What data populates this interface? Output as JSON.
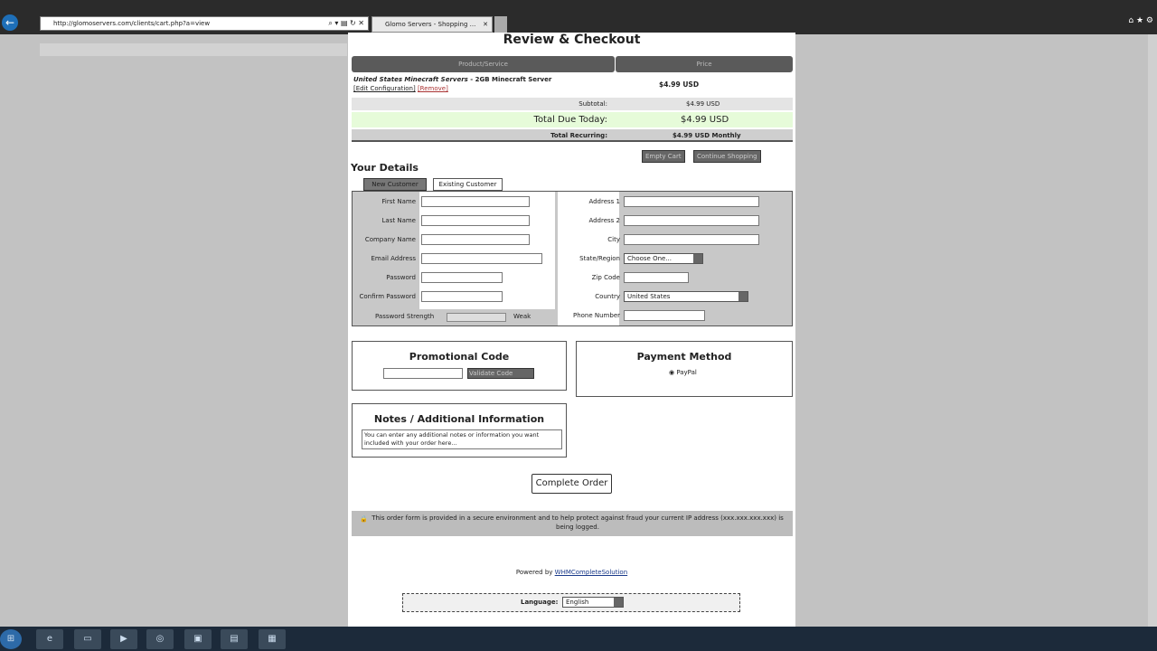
{
  "browser": {
    "url": "http://glomoservers.com/clients/cart.php?a=view",
    "tab_title": "Glomo Servers - Shopping ...",
    "address_controls": "⌕ ▾ ▤ ↻ ✕",
    "tab_close": "✕",
    "back_icon": "arrow-left-icon",
    "right_controls": "⌂ ★ ⚙"
  },
  "page": {
    "title": "Review & Checkout"
  },
  "cart": {
    "col_product": "Product/Service",
    "col_price": "Price",
    "item_name": "United States Minecraft Servers",
    "item_desc": " - 2GB Minecraft Server",
    "edit_link": "[Edit Configuration]",
    "remove_link": "[Remove]",
    "item_price": "$4.99 USD",
    "subtotal_label": "Subtotal:",
    "subtotal": "$4.99 USD",
    "total_label": "Total Due Today:",
    "total": "$4.99 USD",
    "recurring_label": "Total Recurring:",
    "recurring": "$4.99 USD Monthly",
    "empty_cart": "Empty Cart",
    "continue_shopping": "Continue Shopping"
  },
  "details": {
    "title": "Your Details",
    "tab_new": "New Customer",
    "tab_existing": "Existing Customer",
    "left_fields": [
      "First Name",
      "Last Name",
      "Company Name",
      "Email Address",
      "Password",
      "Confirm Password"
    ],
    "right_fields": [
      "Address 1",
      "Address 2",
      "City",
      "State/Region",
      "Zip Code",
      "Country",
      "Phone Number"
    ],
    "state_value": "Choose One...",
    "country_value": "United States",
    "strength_label": "Password Strength",
    "strength_value": "Weak"
  },
  "promo": {
    "title": "Promotional Code",
    "button": "Validate Code"
  },
  "payment": {
    "title": "Payment Method",
    "option": "PayPal"
  },
  "notes": {
    "title": "Notes / Additional Information",
    "placeholder": "You can enter any additional notes or information you want included with your order here..."
  },
  "complete_button": "Complete Order",
  "security_notice": "This order form is provided in a secure environment and to help protect against fraud your current IP address (xxx.xxx.xxx.xxx) is being logged.",
  "footer": {
    "powered_by": "Powered by ",
    "powered_link": "WHMCompleteSolution",
    "language_label": "Language:",
    "language_value": "English"
  },
  "colors": {
    "total_row": "#e6fbd9",
    "header": "#5a5a5a",
    "accent_link": "#1a3a8a"
  }
}
